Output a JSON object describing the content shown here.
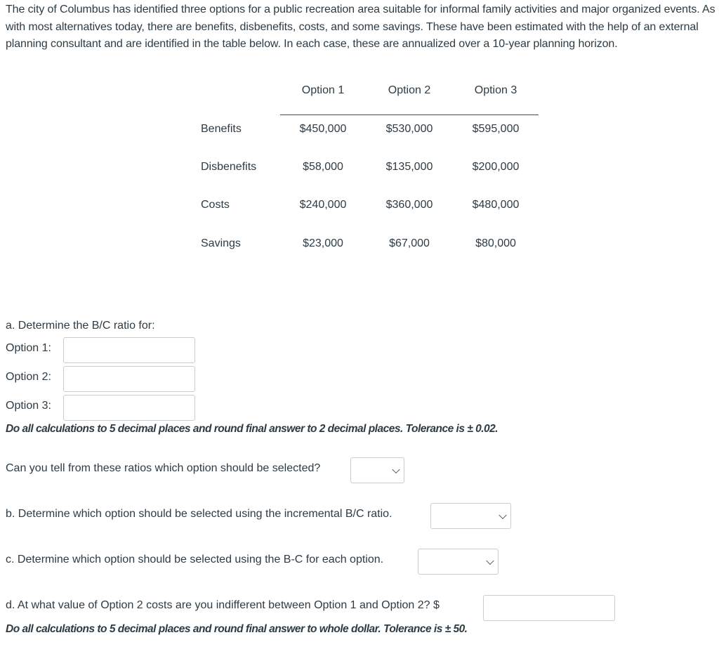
{
  "intro": "The city of Columbus has identified three options for a public recreation area suitable for informal family activities and major organized events. As with most alternatives today, there are benefits, disbenefits, costs, and some savings. These have been estimated with the help of an external planning consultant and are identified in the table below. In each case, these are annualized over a 10-year planning horizon.",
  "table": {
    "headers": [
      "Option 1",
      "Option 2",
      "Option 3"
    ],
    "rows": [
      {
        "label": "Benefits",
        "values": [
          "$450,000",
          "$530,000",
          "$595,000"
        ]
      },
      {
        "label": "Disbenefits",
        "values": [
          "$58,000",
          "$135,000",
          "$200,000"
        ]
      },
      {
        "label": "Costs",
        "values": [
          "$240,000",
          "$360,000",
          "$480,000"
        ]
      },
      {
        "label": "Savings",
        "values": [
          "$23,000",
          "$67,000",
          "$80,000"
        ]
      }
    ]
  },
  "part_a": {
    "prompt": "a. Determine the B/C ratio for:",
    "fields": [
      {
        "label": "Option 1:",
        "value": ""
      },
      {
        "label": "Option 2:",
        "value": ""
      },
      {
        "label": "Option 3:",
        "value": ""
      }
    ],
    "note": "Do all calculations to 5 decimal places and round final answer to 2 decimal places. Tolerance is ± 0.02.",
    "question": "Can you tell from these ratios which option should be selected?",
    "select_value": ""
  },
  "part_b": {
    "prompt": "b. Determine which option should be selected using the incremental B/C ratio.",
    "select_value": ""
  },
  "part_c": {
    "prompt": "c. Determine which option should be selected using the B-C for each option.",
    "select_value": ""
  },
  "part_d": {
    "prompt": "d. At what value of Option 2 costs are you indifferent between Option 1 and Option 2? $",
    "value": "",
    "note": "Do all calculations to 5 decimal places and round final answer to whole dollar. Tolerance is ± 50."
  }
}
